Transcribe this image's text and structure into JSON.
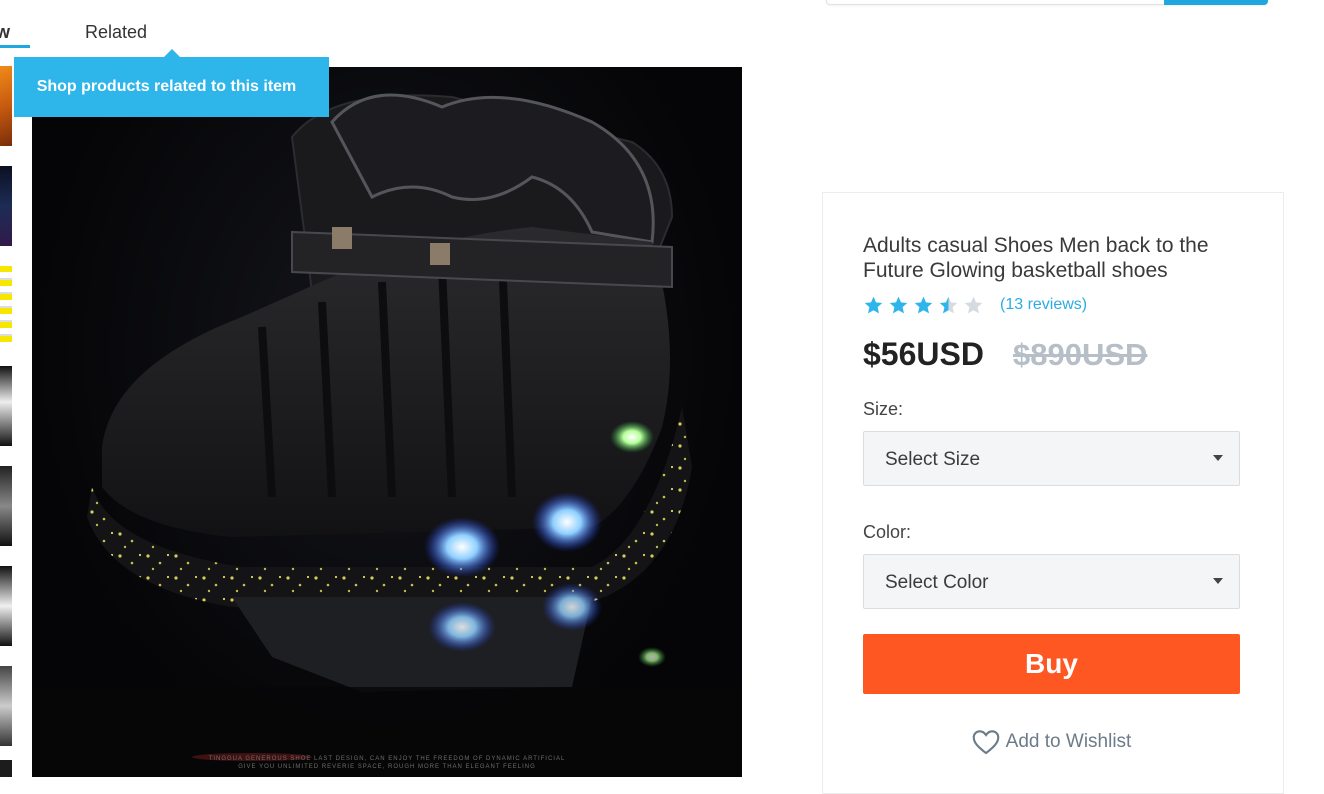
{
  "tabs": {
    "overview_label": "ew",
    "related_label": "Related",
    "tooltip": "Shop products related to this item"
  },
  "main_image": {
    "caption_line1": "TINGGUA GENEROUS SHOE LAST DESIGN, CAN ENJOY THE FREEDOM OF DYNAMIC ARTIFICIAL",
    "caption_line2": "GIVE YOU UNLIMITED REVERIE SPACE, ROUGH MORE THAN ELEGANT FEELING"
  },
  "product": {
    "title": "Adults casual Shoes Men back to the Future Glowing basketball shoes",
    "rating": 3.5,
    "rating_max": 5,
    "reviews_text": "(13 reviews)",
    "price": "$56USD",
    "old_price": "$890USD",
    "size_label": "Size:",
    "size_select": "Select Size",
    "color_label": "Color:",
    "color_select": "Select Color",
    "buy_label": "Buy",
    "wishlist_label": "Add to Wishlist"
  },
  "colors": {
    "accent": "#1fa8e0",
    "buy": "#ff5722",
    "star": "#2eb5ea",
    "star_empty": "#d5dbe0"
  }
}
